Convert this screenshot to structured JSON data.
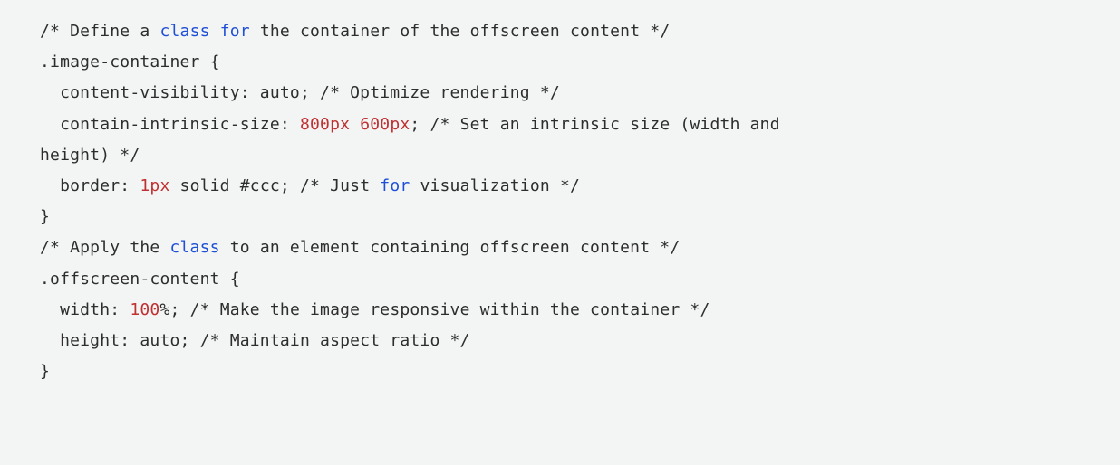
{
  "code": {
    "lines": [
      [
        {
          "t": "/* Define a ",
          "c": "base"
        },
        {
          "t": "class",
          "c": "kw"
        },
        {
          "t": " ",
          "c": "base"
        },
        {
          "t": "for",
          "c": "kw"
        },
        {
          "t": " the container of the offscreen content */",
          "c": "base"
        }
      ],
      [
        {
          "t": ".image-container {",
          "c": "base"
        }
      ],
      [
        {
          "t": "  content-visibility: auto; /* Optimize rendering */",
          "c": "base"
        }
      ],
      [
        {
          "t": "  contain-intrinsic-size: ",
          "c": "base"
        },
        {
          "t": "800px",
          "c": "num"
        },
        {
          "t": " ",
          "c": "base"
        },
        {
          "t": "600px",
          "c": "num"
        },
        {
          "t": "; /* Set an intrinsic size (width and",
          "c": "base"
        }
      ],
      [
        {
          "t": "height) */",
          "c": "base"
        }
      ],
      [
        {
          "t": "  border: ",
          "c": "base"
        },
        {
          "t": "1px",
          "c": "num"
        },
        {
          "t": " solid #ccc; /* Just ",
          "c": "base"
        },
        {
          "t": "for",
          "c": "kw"
        },
        {
          "t": " visualization */",
          "c": "base"
        }
      ],
      [
        {
          "t": "}",
          "c": "base"
        }
      ],
      [
        {
          "t": "",
          "c": "base"
        }
      ],
      [
        {
          "t": "/* Apply the ",
          "c": "base"
        },
        {
          "t": "class",
          "c": "kw"
        },
        {
          "t": " to an element containing offscreen content */",
          "c": "base"
        }
      ],
      [
        {
          "t": ".offscreen-content {",
          "c": "base"
        }
      ],
      [
        {
          "t": "  width: ",
          "c": "base"
        },
        {
          "t": "100",
          "c": "num"
        },
        {
          "t": "%; /* Make the image responsive within the container */",
          "c": "base"
        }
      ],
      [
        {
          "t": "  height: auto; /* Maintain aspect ratio */",
          "c": "base"
        }
      ],
      [
        {
          "t": "}",
          "c": "base"
        }
      ]
    ]
  },
  "colors": {
    "background": "#f3f4f4",
    "base": "#2d2d2d",
    "keyword": "#1f4fd6",
    "number": "#c03030"
  }
}
